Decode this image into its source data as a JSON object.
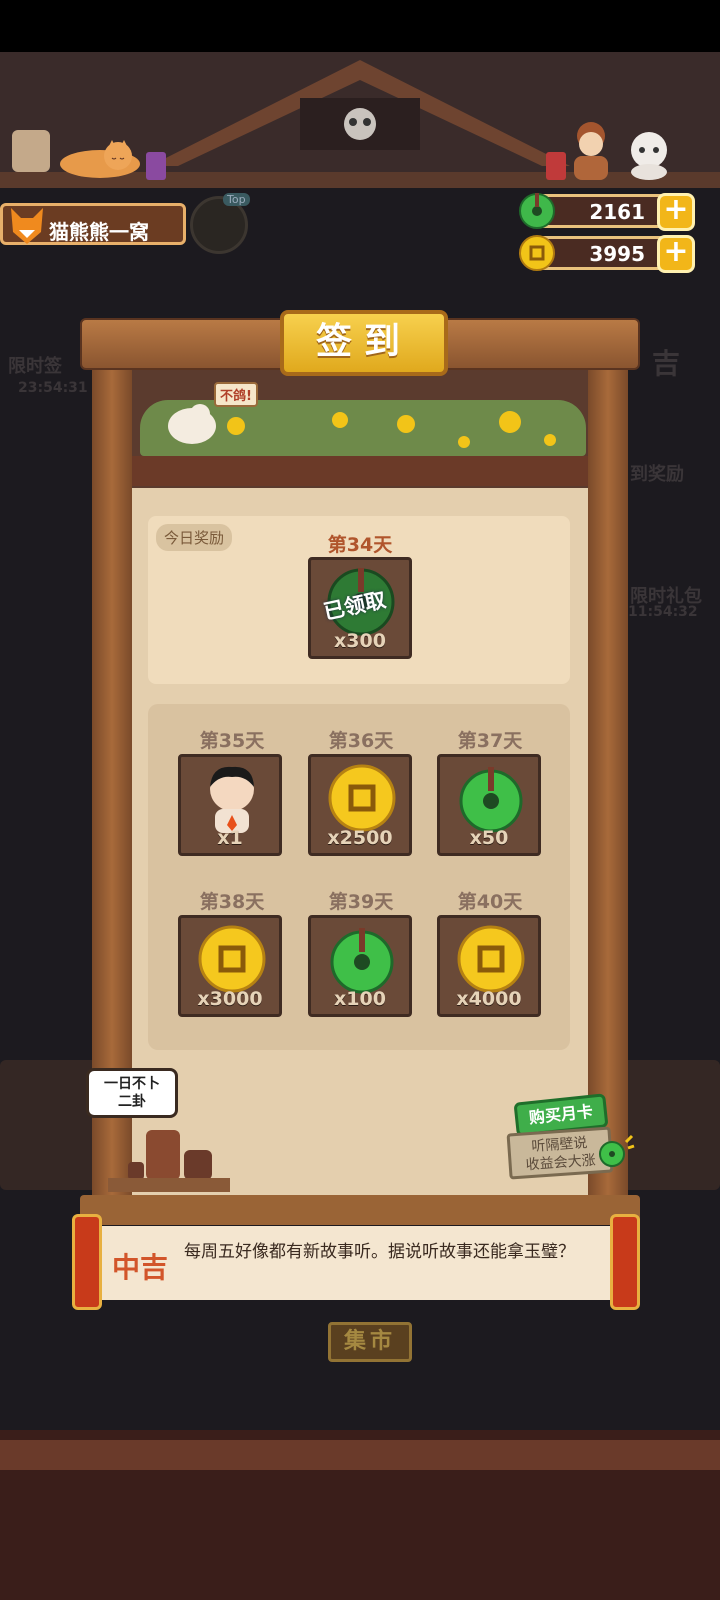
{
  "player": {
    "name": "猫熊熊一窝",
    "badge": "Top"
  },
  "currency": {
    "jade": {
      "icon": "jade-coin-icon",
      "value": "2161"
    },
    "gold": {
      "icon": "gold-coin-icon",
      "value": "3995"
    },
    "plus": "+"
  },
  "background": {
    "left_event_label": "限时签",
    "left_event_timer": "23:54:31",
    "right_event_timer": "11:54:32",
    "right_label_1": "吉",
    "right_label_2": "到奖励",
    "right_label_3": "限时礼包",
    "market": "集市"
  },
  "panel": {
    "title": "签到",
    "scene_bubble": "不鸽!",
    "today": {
      "label": "今日奖励",
      "day": "第34天",
      "amount": "x300",
      "status": "已领取",
      "icon": "jade-coin-icon"
    },
    "days": [
      {
        "day": "第35天",
        "amount": "x1",
        "icon": "character-avatar-icon"
      },
      {
        "day": "第36天",
        "amount": "x2500",
        "icon": "gold-coin-icon"
      },
      {
        "day": "第37天",
        "amount": "x50",
        "icon": "jade-coin-icon"
      },
      {
        "day": "第38天",
        "amount": "x3000",
        "icon": "gold-coin-icon"
      },
      {
        "day": "第39天",
        "amount": "x100",
        "icon": "jade-coin-icon"
      },
      {
        "day": "第40天",
        "amount": "x4000",
        "icon": "gold-coin-icon"
      }
    ],
    "speech": {
      "line1": "一日不卜",
      "line2": "二卦"
    },
    "monthly": {
      "button": "购买月卡",
      "sign_line1": "听隔壁说",
      "sign_line2": "收益会大涨"
    },
    "fortune": {
      "level": "中吉",
      "text": "每周五好像都有新故事听。据说听故事还能拿玉璧？"
    }
  }
}
